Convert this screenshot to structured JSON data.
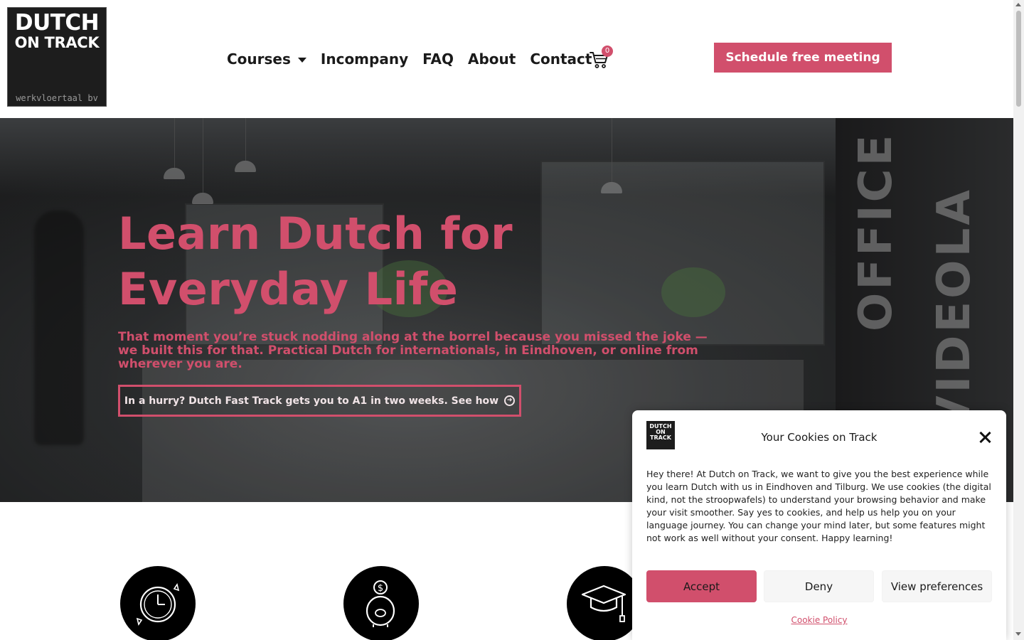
{
  "brand": {
    "logo_line1": "DUTCH",
    "logo_line2": "ON TRACK",
    "logo_sub": "werkvloertaal bv",
    "accent_color": "#d14f6c"
  },
  "nav": {
    "items": [
      {
        "label": "Courses",
        "has_dropdown": true
      },
      {
        "label": "Incompany"
      },
      {
        "label": "FAQ"
      },
      {
        "label": "About"
      },
      {
        "label": "Contact"
      }
    ],
    "cart_icon": "cart-icon",
    "cart_count": "0",
    "cta_label": "Schedule free meeting"
  },
  "hero": {
    "title": "Learn Dutch for Everyday Life",
    "subtitle": "That moment you’re stuck nodding along at the borrel because you missed the joke — we built this for that. Practical Dutch for internationals, in Eindhoven, or online from wherever you are.",
    "button_label": "In a hurry? Dutch Fast Track gets you to A1 in two weeks. See how",
    "button_icon": "arrow-circle-right-icon",
    "background_signage_1": "OFFICE",
    "background_signage_2": "VIDEOLA"
  },
  "features": {
    "icons": [
      "clock-cycle-icon",
      "piggy-bank-icon",
      "graduation-cap-icon"
    ]
  },
  "cookie_banner": {
    "logo_line1": "DUTCH",
    "logo_line2": "ON TRACK",
    "title": "Your Cookies on Track",
    "close_icon": "close-icon",
    "text": "Hey there! At Dutch on Track, we want to give you the best experience while you learn Dutch with us in Eindhoven and Tilburg. We use cookies (the digital kind, not the stroopwafels) to understand your browsing behavior and make your visit smoother. Say yes to cookies, and help us help you on your language journey. You can change your mind later, but some features might not work as well without your consent. Happy learning!",
    "accept_label": "Accept",
    "deny_label": "Deny",
    "preferences_label": "View preferences",
    "policy_link": "Cookie Policy"
  }
}
